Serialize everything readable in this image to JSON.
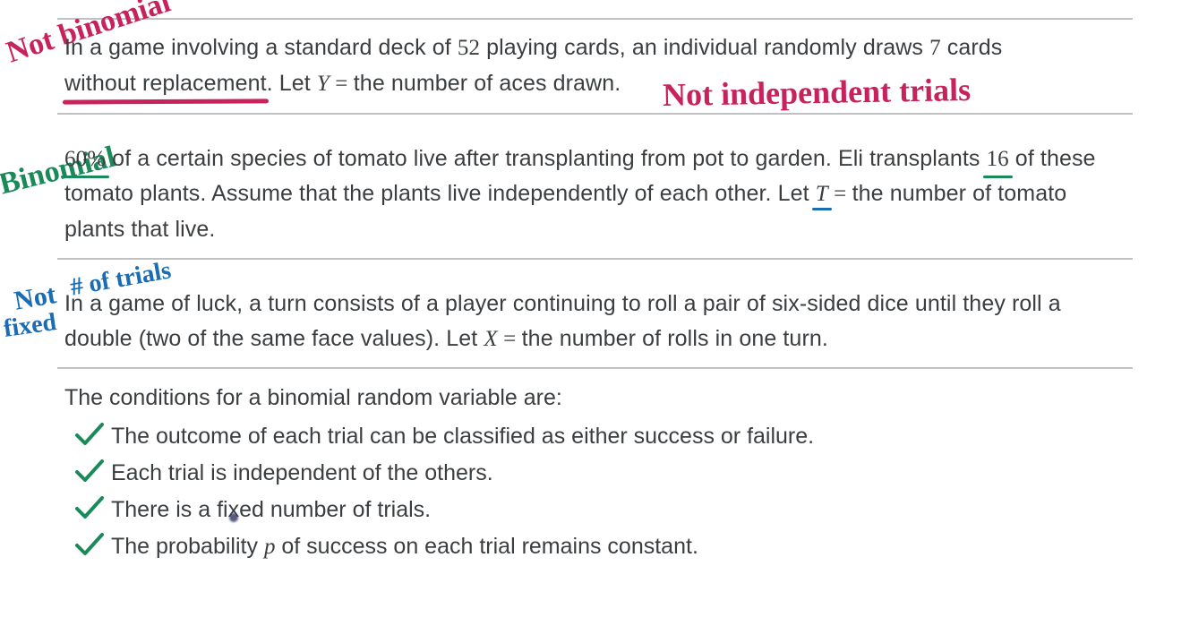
{
  "annotations": {
    "not_binomial": "Not binomial",
    "not_independent": "Not independent trials",
    "binomial": "Binomial",
    "not_fixed_1": "Not",
    "not_fixed_2": "# of trials",
    "fixed": "fixed"
  },
  "problem1": {
    "seg1": "In a game involving a standard deck of ",
    "num_cards": "52",
    "seg2": " playing cards, an individual randomly draws ",
    "num_draw": "7",
    "seg3": " cards ",
    "underlined": "without replacement",
    "seg4": ". Let ",
    "var": "Y",
    "eq": " = ",
    "seg5": "the number of aces drawn."
  },
  "problem2": {
    "pct": "60%",
    "seg1": " of a certain species of tomato live after transplanting from pot to garden. Eli transplants ",
    "num_plants": "16",
    "seg2": " of these tomato plants. Assume that the plants live independently of each other. Let ",
    "var": "T",
    "eq": " = ",
    "seg3": "the number of tomato plants that live."
  },
  "problem3": {
    "seg1": "In a game of luck, a turn consists of a player continuing to roll a pair of six-sided dice until they roll a double (two of the same face values). Let ",
    "var": "X",
    "eq": " = ",
    "seg2": "the number of rolls in one turn."
  },
  "conditions": {
    "intro": "The conditions for a binomial random variable are:",
    "items": [
      "The outcome of each trial can be classified as either success or failure.",
      "Each trial is independent of the others.",
      "There is a fixed number of trials.",
      "The probability p of success on each trial remains constant."
    ],
    "item3_pre": "There is a fi",
    "item3_mid": "x",
    "item3_post": "ed number of trials.",
    "item4_pre": "The probability ",
    "item4_p": "p",
    "item4_post": " of success on each trial remains constant."
  }
}
